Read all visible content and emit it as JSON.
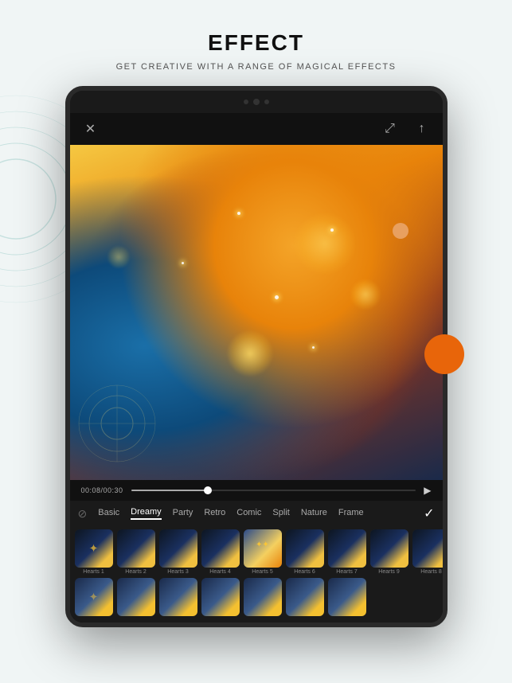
{
  "header": {
    "title": "EFFECT",
    "subtitle": "GET CREATIVE WITH A RANGE OF MAGICAL EFFECTS"
  },
  "toolbar": {
    "close_icon": "✕",
    "expand_icon": "⤢",
    "share_icon": "↑"
  },
  "timeline": {
    "current_time": "00:08",
    "total_time": "00:30",
    "time_label": "00:08/00:30"
  },
  "tabs": [
    {
      "id": "basic",
      "label": "Basic",
      "active": false
    },
    {
      "id": "dreamy",
      "label": "Dreamy",
      "active": true
    },
    {
      "id": "party",
      "label": "Party",
      "active": false
    },
    {
      "id": "retro",
      "label": "Retro",
      "active": false
    },
    {
      "id": "comic",
      "label": "Comic",
      "active": false
    },
    {
      "id": "split",
      "label": "Split",
      "active": false
    },
    {
      "id": "nature",
      "label": "Nature",
      "active": false
    },
    {
      "id": "frame",
      "label": "Frame",
      "active": false
    }
  ],
  "thumbnails_row1": [
    {
      "label": "Hearts 1",
      "selected": false
    },
    {
      "label": "Hearts 2",
      "selected": false
    },
    {
      "label": "Hearts 3",
      "selected": false
    },
    {
      "label": "Hearts 4",
      "selected": false
    },
    {
      "label": "Hearts 5",
      "selected": false
    },
    {
      "label": "Hearts 6",
      "selected": false
    },
    {
      "label": "Hearts 7",
      "selected": false
    },
    {
      "label": "Hearts 9",
      "selected": false
    },
    {
      "label": "Hearts 8",
      "selected": false
    }
  ],
  "thumbnails_row2": [
    {
      "label": "",
      "selected": false
    },
    {
      "label": "",
      "selected": false
    },
    {
      "label": "",
      "selected": false
    },
    {
      "label": "",
      "selected": false
    },
    {
      "label": "",
      "selected": false
    },
    {
      "label": "",
      "selected": false
    },
    {
      "label": "",
      "selected": false
    }
  ],
  "colors": {
    "background": "#e8f0f0",
    "tablet_bg": "#1a1a1a",
    "accent_orange": "#e8650a",
    "accent_salmon": "#e8a060",
    "active_tab_color": "#ffffff"
  }
}
